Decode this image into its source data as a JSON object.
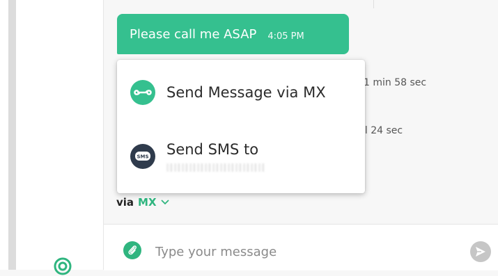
{
  "message": {
    "text": "Please call me ASAP",
    "time": "4:05 PM"
  },
  "calls": [
    {
      "text": "1 min 58 sec"
    },
    {
      "text": "ll  24 sec"
    }
  ],
  "send_via": {
    "prefix": "via",
    "channel": "MX"
  },
  "popup": {
    "items": [
      {
        "label": "Send Message via MX",
        "icon": "mx-infinity-icon"
      },
      {
        "label": "Send SMS to",
        "icon": "sms-icon",
        "icon_text": "SMS"
      }
    ]
  },
  "composer": {
    "placeholder": "Type your message"
  },
  "colors": {
    "accent": "#35c08f",
    "sms_dark": "#2f3b4c"
  }
}
